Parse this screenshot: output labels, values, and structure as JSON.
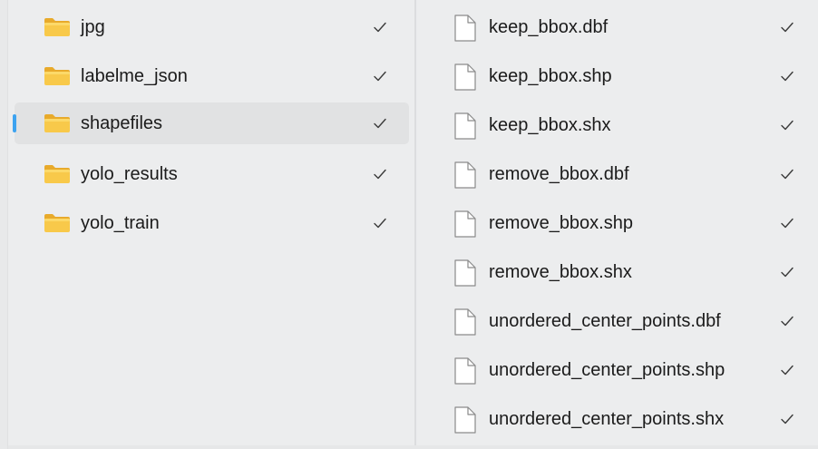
{
  "left_pane": {
    "items": [
      {
        "label": "jpg",
        "icon": "folder-icon",
        "synced": true,
        "selected": false
      },
      {
        "label": "labelme_json",
        "icon": "folder-icon",
        "synced": true,
        "selected": false
      },
      {
        "label": "shapefiles",
        "icon": "folder-icon",
        "synced": true,
        "selected": true
      },
      {
        "label": "yolo_results",
        "icon": "folder-icon",
        "synced": true,
        "selected": false
      },
      {
        "label": "yolo_train",
        "icon": "folder-icon",
        "synced": true,
        "selected": false
      }
    ]
  },
  "right_pane": {
    "items": [
      {
        "label": "keep_bbox.dbf",
        "icon": "file-icon",
        "synced": true
      },
      {
        "label": "keep_bbox.shp",
        "icon": "file-icon",
        "synced": true
      },
      {
        "label": "keep_bbox.shx",
        "icon": "file-icon",
        "synced": true
      },
      {
        "label": "remove_bbox.dbf",
        "icon": "file-icon",
        "synced": true
      },
      {
        "label": "remove_bbox.shp",
        "icon": "file-icon",
        "synced": true
      },
      {
        "label": "remove_bbox.shx",
        "icon": "file-icon",
        "synced": true
      },
      {
        "label": "unordered_center_points.dbf",
        "icon": "file-icon",
        "synced": true
      },
      {
        "label": "unordered_center_points.shp",
        "icon": "file-icon",
        "synced": true
      },
      {
        "label": "unordered_center_points.shx",
        "icon": "file-icon",
        "synced": true
      }
    ]
  },
  "colors": {
    "background": "#ecedee",
    "selected_row": "#e1e2e3",
    "selection_indicator": "#3da3f0",
    "folder_yellow": "#f8c94a",
    "text": "#1b1b1b"
  }
}
